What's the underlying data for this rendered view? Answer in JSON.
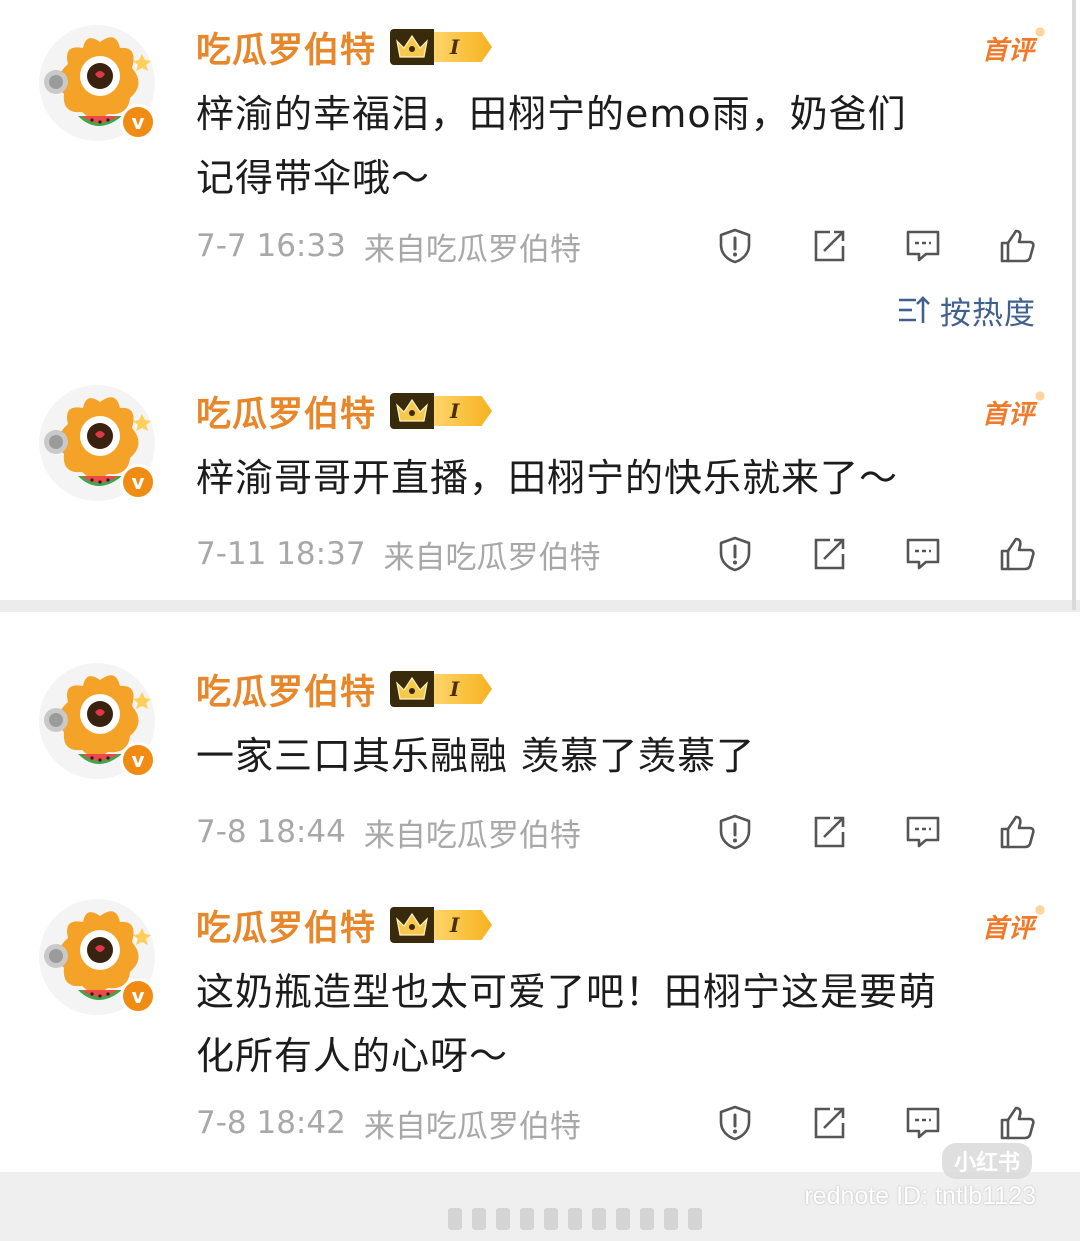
{
  "comments": [
    {
      "username": "吃瓜罗伯特",
      "level": "I",
      "first_tag": "首评",
      "verified": "v",
      "line1": "梓渝的幸福泪，田栩宁的emo雨，奶爸们",
      "line2": "记得带伞哦～",
      "time": "7-7 16:33",
      "source": "来自吃瓜罗伯特"
    },
    {
      "username": "吃瓜罗伯特",
      "level": "I",
      "first_tag": "首评",
      "verified": "v",
      "line1": "梓渝哥哥开直播，田栩宁的快乐就来了～",
      "time": "7-11 18:37",
      "source": "来自吃瓜罗伯特"
    },
    {
      "username": "吃瓜罗伯特",
      "level": "I",
      "verified": "v",
      "line1": "一家三口其乐融融 羡慕了羡慕了",
      "time": "7-8 18:44",
      "source": "来自吃瓜罗伯特"
    },
    {
      "username": "吃瓜罗伯特",
      "level": "I",
      "first_tag": "首评",
      "verified": "v",
      "line1": "这奶瓶造型也太可爱了吧！田栩宁这是要萌",
      "line2": "化所有人的心呀～",
      "time": "7-8 18:42",
      "source": "来自吃瓜罗伯特"
    }
  ],
  "sort": {
    "label": "按热度",
    "icon": "sort-icon"
  },
  "actions": [
    "report-icon",
    "repost-icon",
    "comment-icon",
    "like-icon"
  ],
  "watermark": {
    "logo": "小红书",
    "id": "rednote ID: tntlb1123"
  },
  "colors": {
    "username": "#e8862a",
    "first_tag": "#f07a2a",
    "meta": "#a8a8a8",
    "sort": "#40608f",
    "verified": "#f08c14"
  }
}
